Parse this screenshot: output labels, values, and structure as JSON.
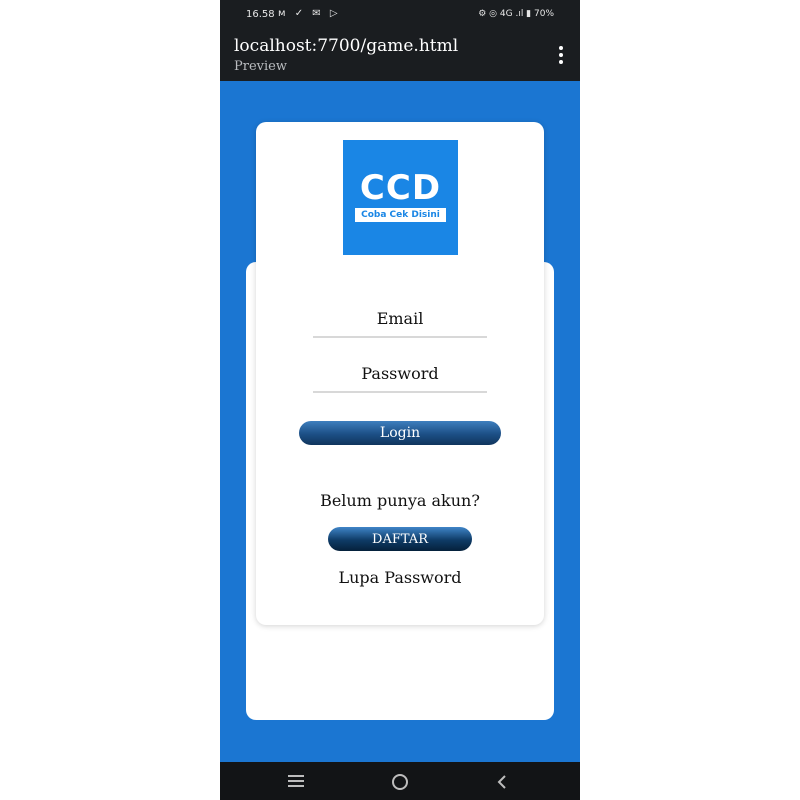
{
  "statusbar": {
    "time": "16.58",
    "left_icons": "ᴍ ✓ ✉ ▷",
    "right_status": "⚙ ◎ 4G .ıl ▮ 70%"
  },
  "appbar": {
    "title": "localhost:7700/game.html",
    "subtitle": "Preview",
    "menu_icon": "more-vertical-icon"
  },
  "logo": {
    "mark": "CCD",
    "tagline": "Coba Cek Disini",
    "color": "#1a86e5"
  },
  "form": {
    "email_placeholder": "Email",
    "password_placeholder": "Password",
    "login_label": "Login",
    "register_prompt": "Belum punya akun?",
    "register_label": "DAFTAR",
    "forgot_label": "Lupa Password"
  },
  "colors": {
    "background": "#1b76d2",
    "bars": "#1a1d20",
    "button": "#1c4f86"
  },
  "navbar": {
    "recents_icon": "recents-icon",
    "home_icon": "home-icon",
    "back_icon": "back-icon"
  }
}
